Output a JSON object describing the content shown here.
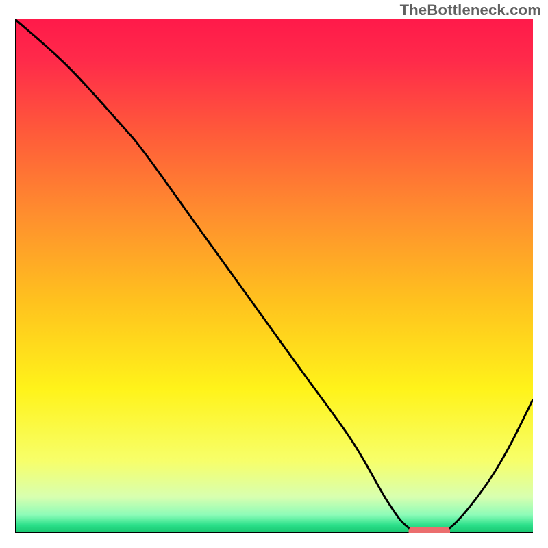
{
  "watermark": "TheBottleneck.com",
  "chart_data": {
    "type": "line",
    "title": "",
    "xlabel": "",
    "ylabel": "",
    "xlim": [
      0,
      100
    ],
    "ylim": [
      0,
      100
    ],
    "grid": false,
    "series": [
      {
        "name": "bottleneck-curve",
        "x": [
          0,
          10,
          20,
          25,
          35,
          45,
          55,
          65,
          72,
          76,
          80,
          84,
          90,
          95,
          100
        ],
        "y": [
          100,
          91,
          80,
          74,
          60,
          46,
          32,
          18,
          6,
          1,
          0,
          1,
          8,
          16,
          26
        ]
      }
    ],
    "marker": {
      "name": "optimal-range",
      "x_start": 76,
      "x_end": 84,
      "y": 0
    },
    "gradient_stops": [
      {
        "offset": 0.0,
        "color": "#ff1a4a"
      },
      {
        "offset": 0.08,
        "color": "#ff2a4a"
      },
      {
        "offset": 0.22,
        "color": "#ff5a3a"
      },
      {
        "offset": 0.38,
        "color": "#ff8e2e"
      },
      {
        "offset": 0.55,
        "color": "#ffc21e"
      },
      {
        "offset": 0.72,
        "color": "#fff31a"
      },
      {
        "offset": 0.86,
        "color": "#f7ff6a"
      },
      {
        "offset": 0.93,
        "color": "#d8ffb0"
      },
      {
        "offset": 0.965,
        "color": "#8dfcb8"
      },
      {
        "offset": 0.985,
        "color": "#2be08a"
      },
      {
        "offset": 1.0,
        "color": "#17c26d"
      }
    ],
    "marker_color": "#eb6e6e",
    "curve_color": "#000000",
    "axis_color": "#000000"
  }
}
